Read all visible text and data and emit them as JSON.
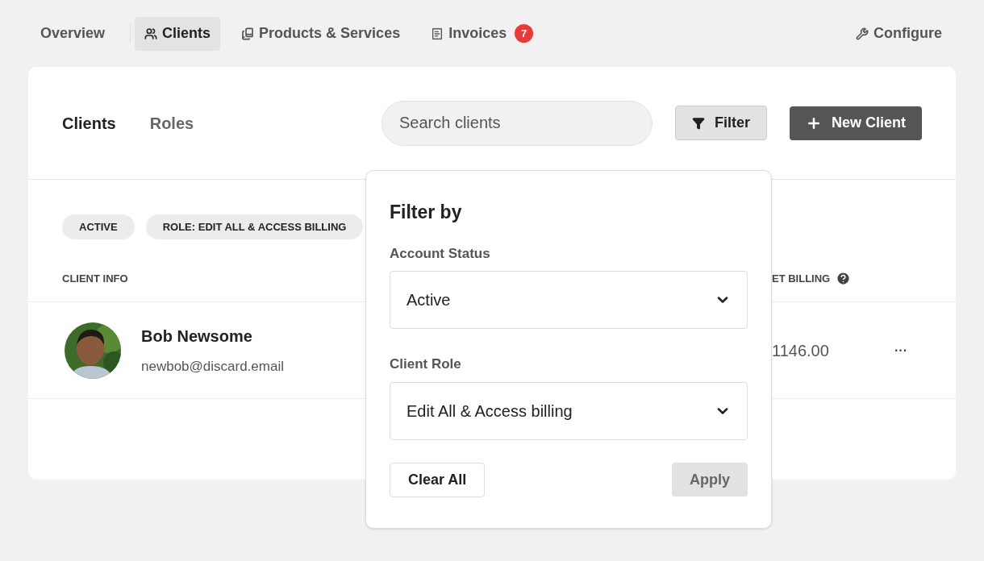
{
  "nav": {
    "items": [
      {
        "label": "Overview",
        "kind": "plain",
        "selected": false
      },
      {
        "label": "Clients",
        "kind": "people",
        "selected": true
      },
      {
        "label": "Products & Services",
        "kind": "books",
        "selected": false
      },
      {
        "label": "Invoices",
        "kind": "invoice",
        "selected": false,
        "badge": "7"
      }
    ],
    "configure": "Configure"
  },
  "card": {
    "tabs": [
      {
        "label": "Clients",
        "selected": true
      },
      {
        "label": "Roles",
        "selected": false
      }
    ],
    "search": {
      "placeholder": "Search clients"
    },
    "filter_button": "Filter",
    "new_button": "New Client",
    "chips": [
      "ACTIVE",
      "ROLE: EDIT ALL & ACCESS BILLING"
    ],
    "columns": [
      "CLIENT INFO",
      "ET BILLING"
    ],
    "rows": [
      {
        "name": "Bob Newsome",
        "email": "newbob@discard.email",
        "billing": "1146.00",
        "menu": "···"
      }
    ]
  },
  "filter_popover": {
    "title": "Filter by",
    "fields": [
      {
        "label": "Account Status",
        "value": "Active"
      },
      {
        "label": "Client Role",
        "value": "Edit All & Access billing"
      }
    ],
    "clear": "Clear All",
    "apply": {
      "label": "Apply",
      "disabled": true
    }
  }
}
